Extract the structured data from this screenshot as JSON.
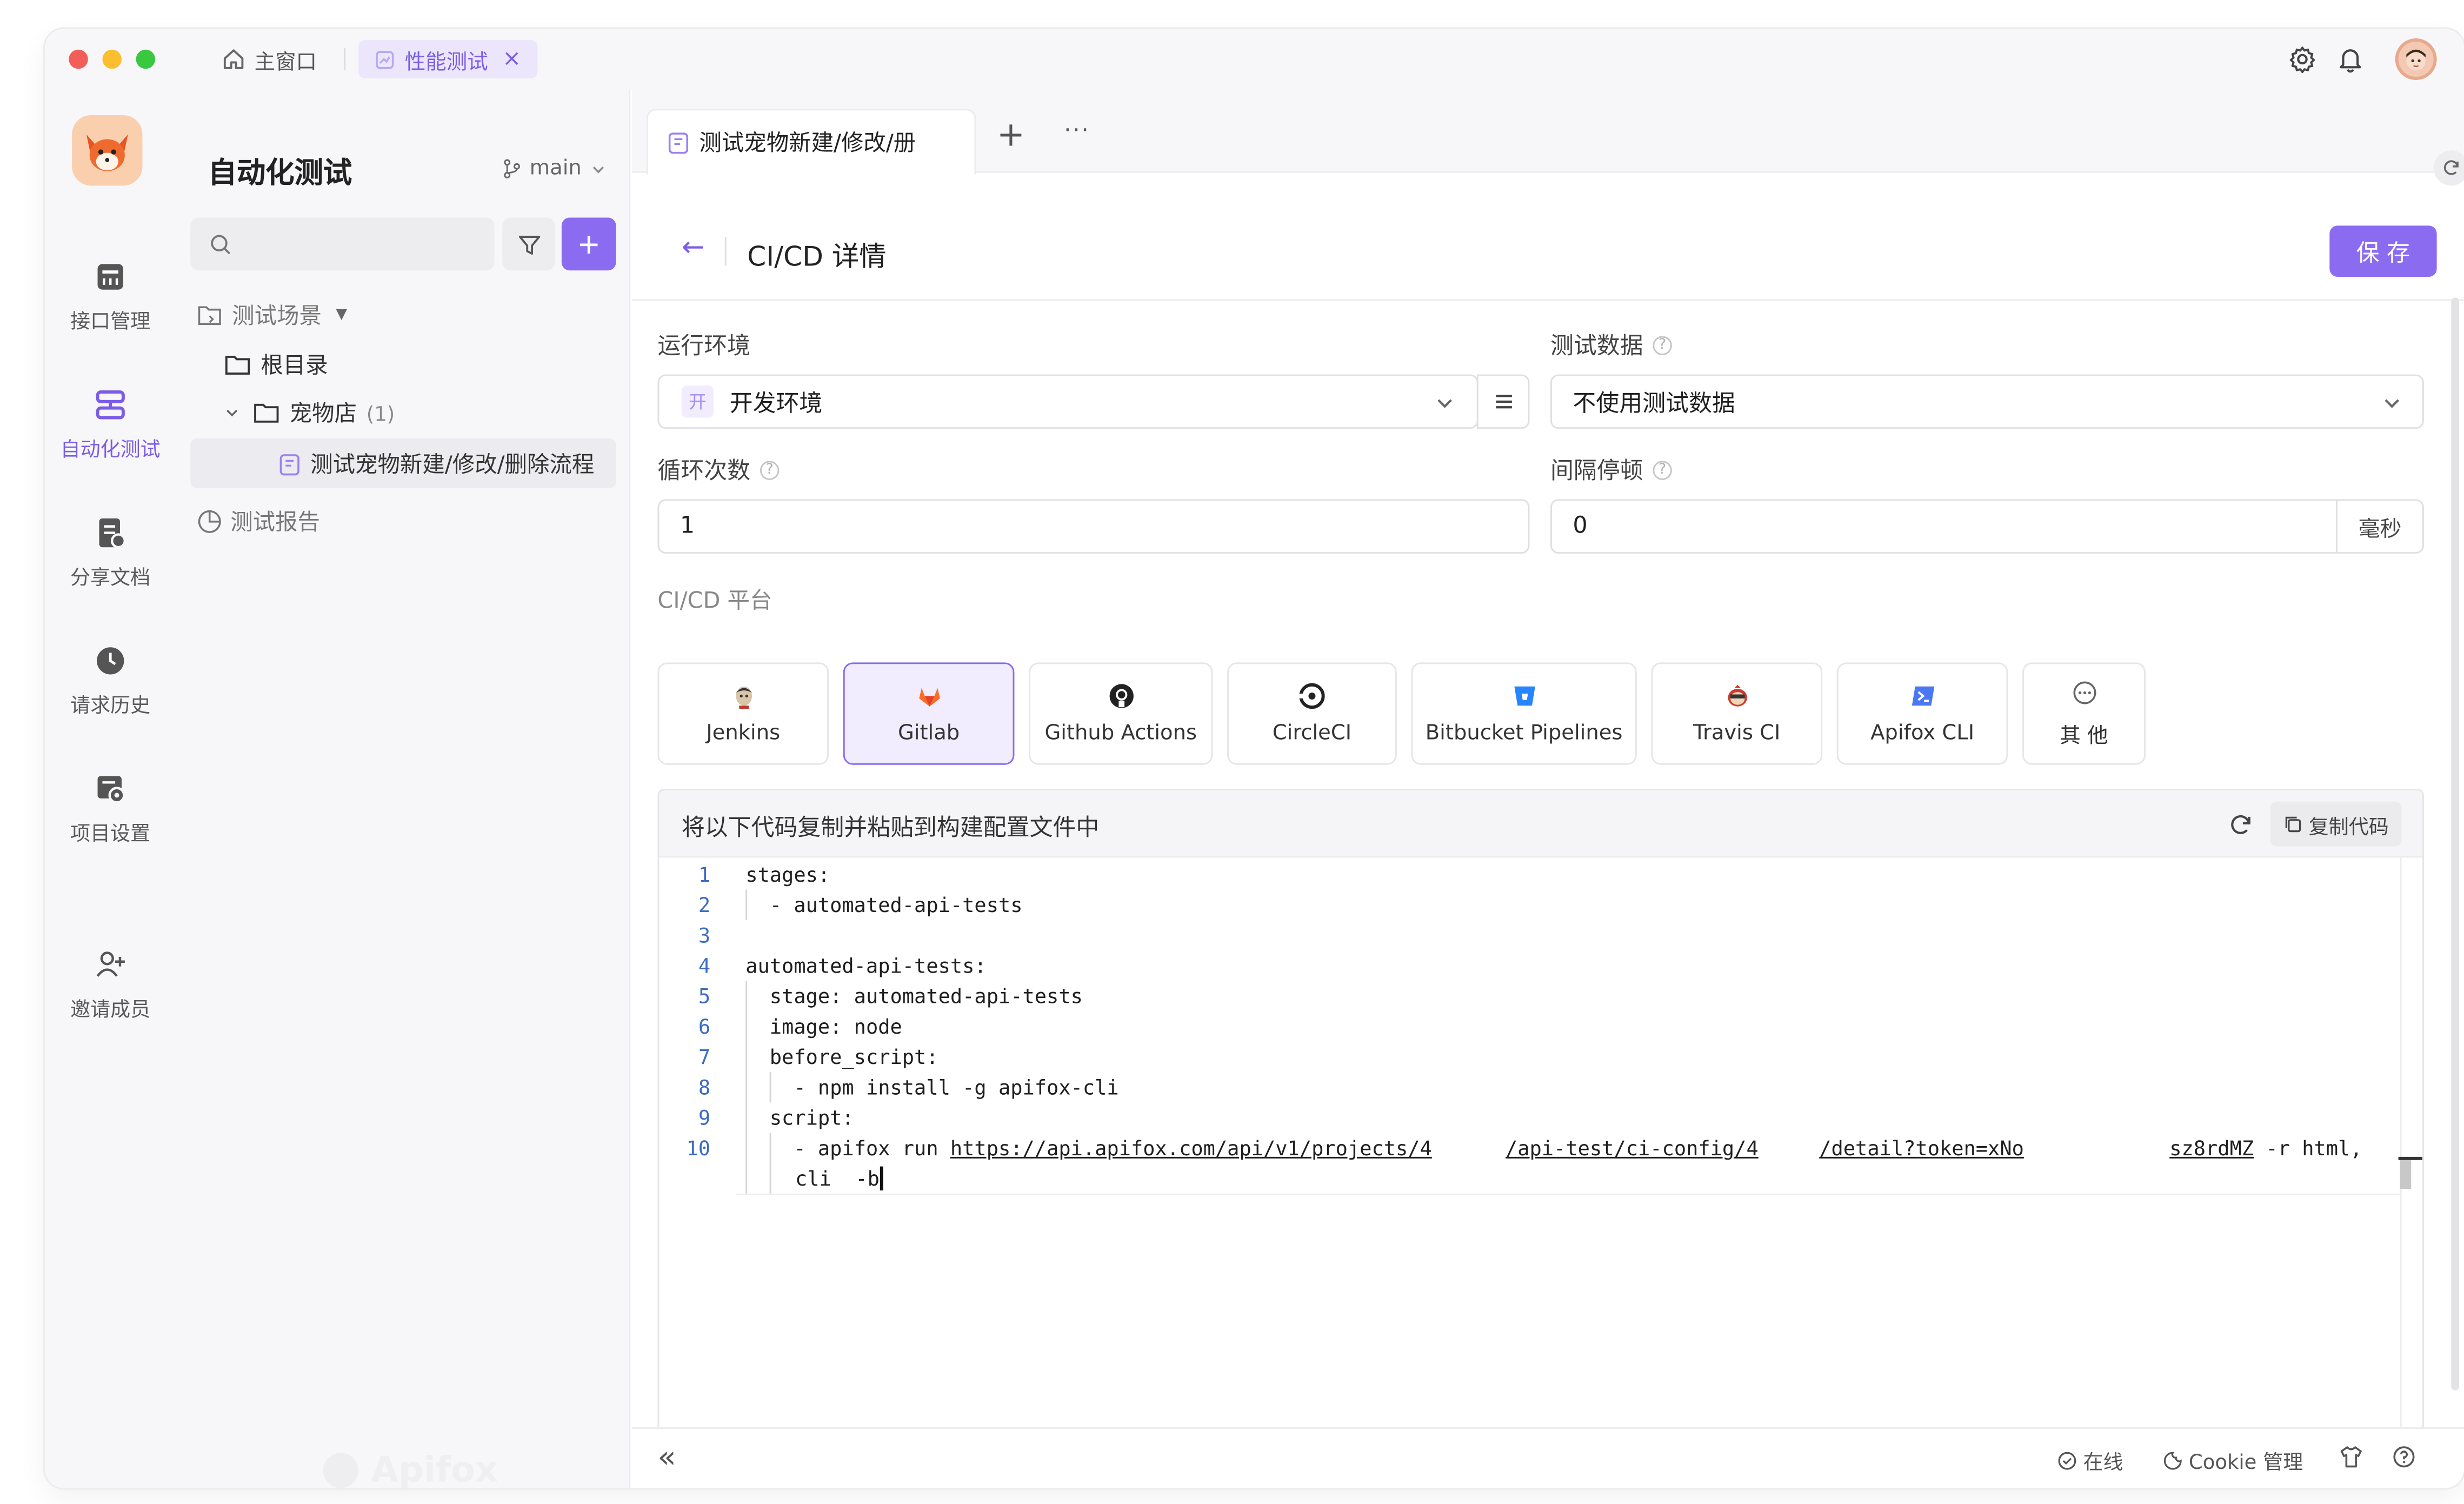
{
  "titlebar": {
    "home_tab": "主窗口",
    "active_tab": "性能测试",
    "close_glyph": "×"
  },
  "rail": {
    "items": [
      {
        "label": "接口管理",
        "icon": "api-icon"
      },
      {
        "label": "自动化测试",
        "icon": "automation-icon"
      },
      {
        "label": "分享文档",
        "icon": "share-doc-icon"
      },
      {
        "label": "请求历史",
        "icon": "history-icon"
      },
      {
        "label": "项目设置",
        "icon": "settings-icon"
      },
      {
        "label": "邀请成员",
        "icon": "invite-icon"
      }
    ],
    "active_index": 1
  },
  "tree": {
    "title": "自动化测试",
    "branch": "main",
    "search_placeholder": "",
    "section_scenarios": "测试场景",
    "root_folder": "根目录",
    "folder": "宠物店",
    "folder_count": "(1)",
    "scenario": "测试宠物新建/修改/删除流程",
    "section_reports": "测试报告",
    "watermark": "Apifox"
  },
  "main": {
    "tab_label": "测试宠物新建/修改/册",
    "add_tab_glyph": "+",
    "more_glyph": "···",
    "back_glyph": "←",
    "page_title": "CI/CD 详情",
    "save_label": "保 存",
    "env_label": "运行环境",
    "env_badge": "开",
    "env_value": "开发环境",
    "test_data_label": "测试数据",
    "test_data_value": "不使用测试数据",
    "loop_label": "循环次数",
    "loop_value": "1",
    "interval_label": "间隔停顿",
    "interval_value": "0",
    "interval_unit": "毫秒",
    "platform_label": "CI/CD 平台",
    "platforms": [
      "Jenkins",
      "Gitlab",
      "Github Actions",
      "CircleCI",
      "Bitbucket Pipelines",
      "Travis CI",
      "Apifox CLI",
      "其 他"
    ],
    "selected_platform": "Gitlab",
    "code_title": "将以下代码复制并粘贴到构建配置文件中",
    "copy_label": "复制代码",
    "code_lines": [
      {
        "n": "1",
        "text": "stages:"
      },
      {
        "n": "2",
        "text": "  - automated-api-tests"
      },
      {
        "n": "3",
        "text": ""
      },
      {
        "n": "4",
        "text": "automated-api-tests:"
      },
      {
        "n": "5",
        "text": "  stage: automated-api-tests"
      },
      {
        "n": "6",
        "text": "  image: node"
      },
      {
        "n": "7",
        "text": "  before_script:"
      },
      {
        "n": "8",
        "text": "    - npm install -g apifox-cli"
      },
      {
        "n": "9",
        "text": "  script:"
      }
    ],
    "line10": {
      "n": "10",
      "prefix": "    - apifox run ",
      "url_a": "https://api.apifox.com/api/v1/projects/4",
      "url_b": "/api-test/ci-config/4",
      "url_c": "/detail?token=xNo",
      "url_d": "sz8rdMZ",
      "suffix": " -r html,",
      "wrap": "cli  -b"
    }
  },
  "statusbar": {
    "collapse_glyph": "«",
    "online": "在线",
    "cookie": "Cookie 管理"
  }
}
